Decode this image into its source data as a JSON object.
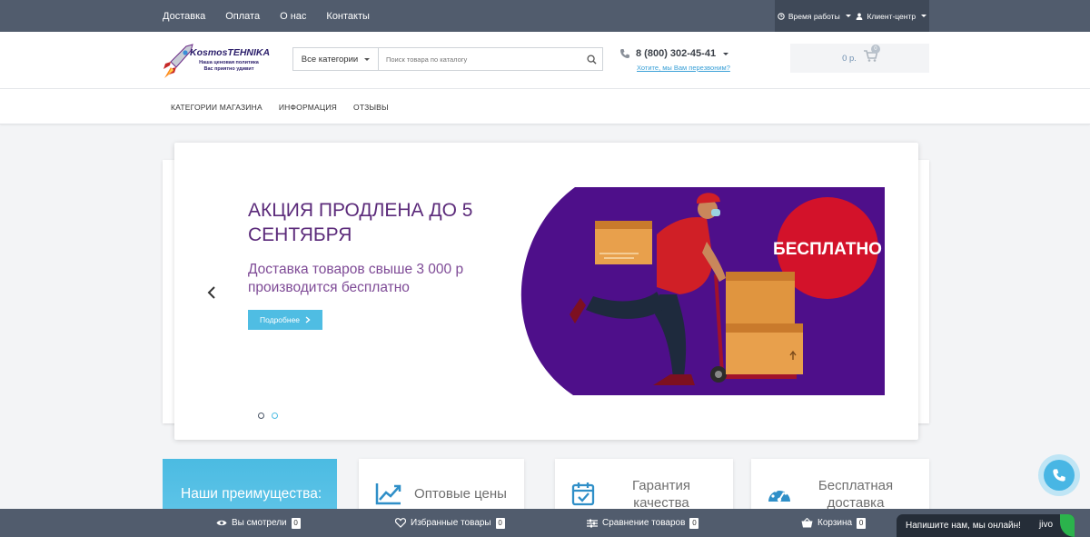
{
  "topbar": {
    "links": [
      "Доставка",
      "Оплата",
      "О нас",
      "Контакты"
    ],
    "hours_label": "Время работы",
    "client_label": "Клиент-центр"
  },
  "header": {
    "logo_title": "KosmosTEHNIKA",
    "logo_tagline_1": "Наша ценовая политика",
    "logo_tagline_2": "Вас приятно удивит",
    "search_category": "Все категории",
    "search_placeholder": "Поиск товара по каталогу",
    "phone": "8 (800) 302-45-41",
    "callback": "Хотите, мы Вам перезвоним?",
    "cart_total": "0 р.",
    "cart_count": "0"
  },
  "menu": {
    "items": [
      "КАТЕГОРИИ МАГАЗИНА",
      "ИНФОРМАЦИЯ",
      "ОТЗЫВЫ"
    ]
  },
  "slider": {
    "title": "АКЦИЯ ПРОДЛЕНА ДО 5 СЕНТЯБРЯ",
    "subtitle": "Доставка товаров свыше 3 000 р производится бесплатно",
    "button": "Подробнее",
    "banner_text": "БЕСПЛАТНО",
    "active_slide": 1,
    "slide_count": 2
  },
  "advantages": {
    "heading": "Наши преимущества:",
    "items": [
      {
        "line1": "Оптовые цены",
        "line2": ""
      },
      {
        "line1": "Гарантия",
        "line2": "качества"
      },
      {
        "line1": "Бесплатная",
        "line2": "доставка"
      }
    ]
  },
  "bottombar": {
    "viewed": "Вы смотрели",
    "viewed_count": "0",
    "favorites": "Избранные товары",
    "favorites_count": "0",
    "compare": "Сравнение товаров",
    "compare_count": "0",
    "cart": "Корзина",
    "cart_count": "0"
  },
  "chat": {
    "text": "Напишите нам, мы онлайн!",
    "brand": "jivo"
  },
  "colors": {
    "topbar": "#515c6d",
    "accent": "#4fbde3",
    "banner_purple": "#4e0f8a",
    "banner_red": "#d3122a"
  }
}
